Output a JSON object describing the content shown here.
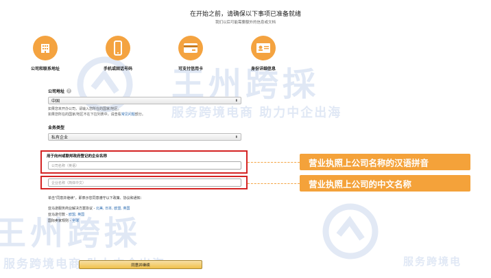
{
  "header": {
    "title": "在开始之前，请确保以下事项已准备就绪",
    "subtitle": "我们以后可能需要额外的信息或文档"
  },
  "steps": [
    {
      "label": "公司和联系地址",
      "icon": "building-icon"
    },
    {
      "label": "手机或固话号码",
      "icon": "phone-icon"
    },
    {
      "label": "可支付信用卡",
      "icon": "credit-card-icon"
    },
    {
      "label": "身份详细信息",
      "icon": "id-card-icon"
    }
  ],
  "form": {
    "address_label": "公司地址",
    "country_value": "中国",
    "country_hint_1": "如果您未开办公司，请输入您所在的国家/地区。",
    "country_hint_2_prefix": "如果您所在的国家/地区不在下拉列表中，请查看",
    "country_hint_2_link": "常见问题",
    "country_hint_2_suffix": "部分。",
    "business_type_label": "业务类型",
    "business_type_value": "私有企业",
    "company_name_label": "用于向州或联邦政府登记的企业名称",
    "company_name_pinyin_placeholder": "公司名称（英语）",
    "company_name_chinese_placeholder": "企业名称（简体中文）"
  },
  "callouts": {
    "pinyin": "营业执照上公司名称的汉语拼音",
    "chinese": "营业执照上公司的中文名称"
  },
  "terms": {
    "intro": "单击\"同意并继续\"，即表示您同意遵守以下政策、协议和通知：",
    "line1_prefix": "亚马逊服务商业解决方案协议 - ",
    "line1_links": "北美, 日本, 欧盟, 英国",
    "line2_prefix": "亚马逊付款 - ",
    "line2_links": "欧盟, 英国",
    "line3_prefix": "国际卖家规则 - ",
    "line3_links": "全球"
  },
  "submit_label": "同意并继续",
  "watermark": {
    "logo_text": "王州跨採",
    "slogan": "服务跨境电商 助力中企出海",
    "slogan_short": "服务跨境电"
  },
  "colors": {
    "accent": "#f4a340",
    "highlight_border": "#d42222",
    "link": "#2a6ab0"
  }
}
